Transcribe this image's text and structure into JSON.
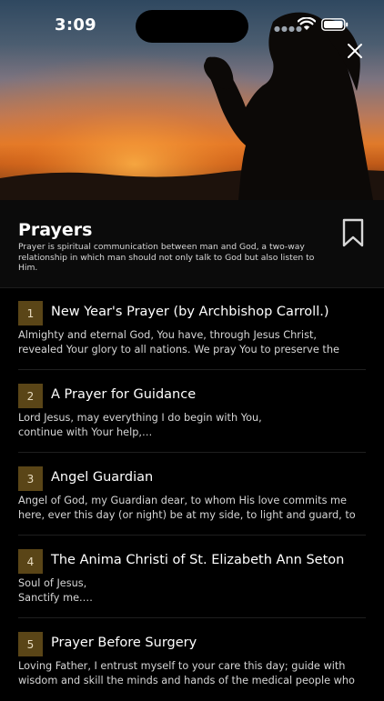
{
  "status_bar": {
    "time": "3:09"
  },
  "header": {
    "title": "Prayers",
    "description": "Prayer is spiritual communication between man and God, a two-way relationship in which man should not only talk to God but also listen to Him."
  },
  "icons": {
    "close": "close-icon",
    "bookmark": "bookmark-icon",
    "wifi": "wifi-icon",
    "battery": "battery-icon"
  },
  "colors": {
    "background": "#000000",
    "number_badge": "#5a4517",
    "text": "#ffffff"
  },
  "prayers": [
    {
      "number": "1",
      "title": "New Year's Prayer (by Archbishop Carroll.)",
      "preview": "Almighty and eternal God, You have, through Jesus Christ, revealed Your glory to all nations. We pray You to preserve the works of Your…"
    },
    {
      "number": "2",
      "title": "A Prayer for Guidance",
      "preview": "Lord Jesus, may everything I do begin with You,\ncontinue with Your help,…"
    },
    {
      "number": "3",
      "title": "Angel Guardian",
      "preview": "Angel of God, my Guardian dear, to whom His love commits me here, ever this day (or night) be at my side, to light and guard, to rule and…"
    },
    {
      "number": "4",
      "title": "The Anima Christi of St. Elizabeth Ann Seton",
      "preview": "Soul of Jesus,\nSanctify me.…"
    },
    {
      "number": "5",
      "title": "Prayer Before Surgery",
      "preview": "Loving Father, I entrust myself to your care this day; guide with wisdom and skill the minds and hands of the medical people who mi…"
    }
  ]
}
